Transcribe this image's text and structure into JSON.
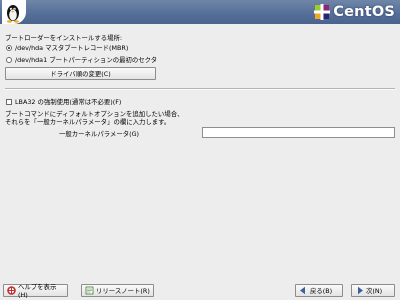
{
  "header": {
    "brand": "CentOS"
  },
  "bootloader": {
    "heading": "ブートローダーをインストールする場所:",
    "options": [
      {
        "label": "/dev/hda マスタブートレコード(MBR)",
        "selected": true
      },
      {
        "label": "/dev/hda1 ブートパーティションの最初のセクタ",
        "selected": false
      }
    ],
    "change_drive_button": "ドライバ順の変更(C)"
  },
  "lba": {
    "checkbox_label": "LBA32 の強制使用(通常は不必要)(F)",
    "checked": false
  },
  "kernel": {
    "description_line1": "ブートコマンドにディフォルトオプションを追加したい場合、",
    "description_line2": "それらを「一般カーネルパラメータ」の欄に入力します。",
    "param_label": "一般カーネルパラメータ(G)",
    "param_value": ""
  },
  "footer": {
    "help_button": "ヘルプを表示(H)",
    "release_notes_button": "リリースノート(R)",
    "back_button": "戻る(B)",
    "next_button": "次(N)"
  },
  "icons": {
    "help": "help-icon",
    "release_notes": "release-notes-icon",
    "back": "back-arrow-icon",
    "next": "next-arrow-icon",
    "logo": "centos-logo-icon",
    "tux": "tux-icon"
  }
}
